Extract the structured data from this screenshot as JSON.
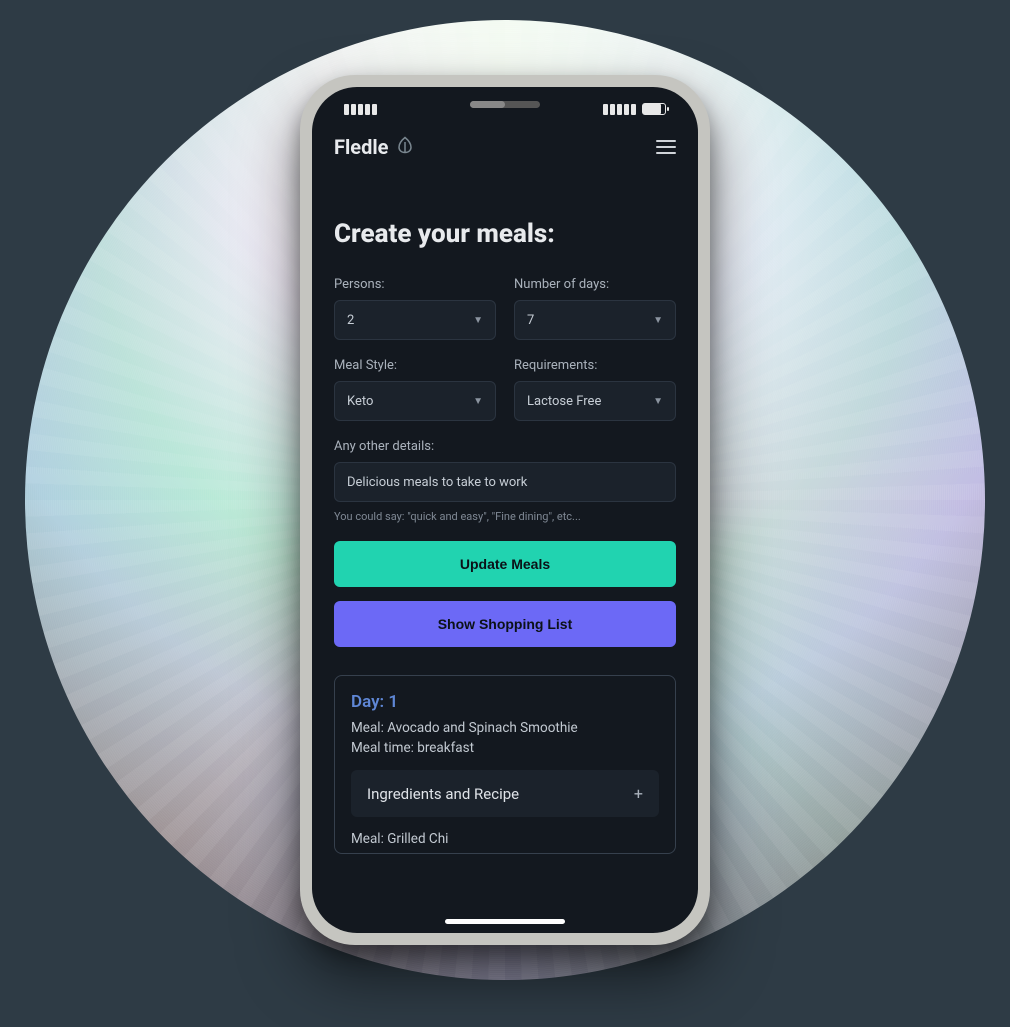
{
  "app": {
    "brand": "Fledle"
  },
  "page": {
    "title": "Create your meals:"
  },
  "form": {
    "persons": {
      "label": "Persons:",
      "value": "2"
    },
    "days": {
      "label": "Number of days:",
      "value": "7"
    },
    "meal_style": {
      "label": "Meal Style:",
      "value": "Keto"
    },
    "requirements": {
      "label": "Requirements:",
      "value": "Lactose Free"
    },
    "details": {
      "label": "Any other details:",
      "value": "Delicious meals to take to work",
      "hint": "You could say: \"quick and easy\", \"Fine dining\", etc..."
    }
  },
  "buttons": {
    "update": "Update Meals",
    "shopping": "Show Shopping List"
  },
  "day": {
    "title": "Day: 1",
    "meal1_name": "Meal: Avocado and Spinach Smoothie",
    "meal1_time": "Meal time: breakfast",
    "accordion_label": "Ingredients and Recipe",
    "meal2_name_truncated": "Meal: Grilled Chi"
  }
}
